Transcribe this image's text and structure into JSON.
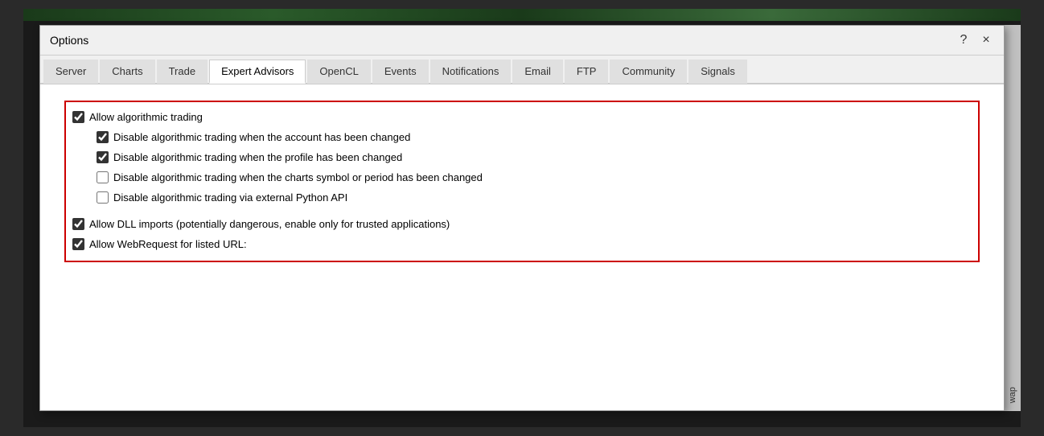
{
  "dialog": {
    "title": "Options",
    "help_btn": "?",
    "close_btn": "×"
  },
  "tabs": [
    {
      "id": "server",
      "label": "Server",
      "active": false
    },
    {
      "id": "charts",
      "label": "Charts",
      "active": false
    },
    {
      "id": "trade",
      "label": "Trade",
      "active": false
    },
    {
      "id": "expert-advisors",
      "label": "Expert Advisors",
      "active": true
    },
    {
      "id": "opencl",
      "label": "OpenCL",
      "active": false
    },
    {
      "id": "events",
      "label": "Events",
      "active": false
    },
    {
      "id": "notifications",
      "label": "Notifications",
      "active": false
    },
    {
      "id": "email",
      "label": "Email",
      "active": false
    },
    {
      "id": "ftp",
      "label": "FTP",
      "active": false
    },
    {
      "id": "community",
      "label": "Community",
      "active": false
    },
    {
      "id": "signals",
      "label": "Signals",
      "active": false
    }
  ],
  "checkboxes": {
    "allow_algo": {
      "label": "Allow algorithmic trading",
      "checked": true
    },
    "disable_account": {
      "label": "Disable algorithmic trading when the account has been changed",
      "checked": true
    },
    "disable_profile": {
      "label": "Disable algorithmic trading when the profile has been changed",
      "checked": true
    },
    "disable_charts": {
      "label": "Disable algorithmic trading when the charts symbol or period has been changed",
      "checked": false
    },
    "disable_python": {
      "label": "Disable algorithmic trading via external Python API",
      "checked": false
    },
    "allow_dll": {
      "label": "Allow DLL imports (potentially dangerous, enable only for trusted applications)",
      "checked": true
    },
    "allow_web": {
      "label": "Allow WebRequest for listed URL:",
      "checked": true
    }
  },
  "right_edge": {
    "text": "wap"
  }
}
